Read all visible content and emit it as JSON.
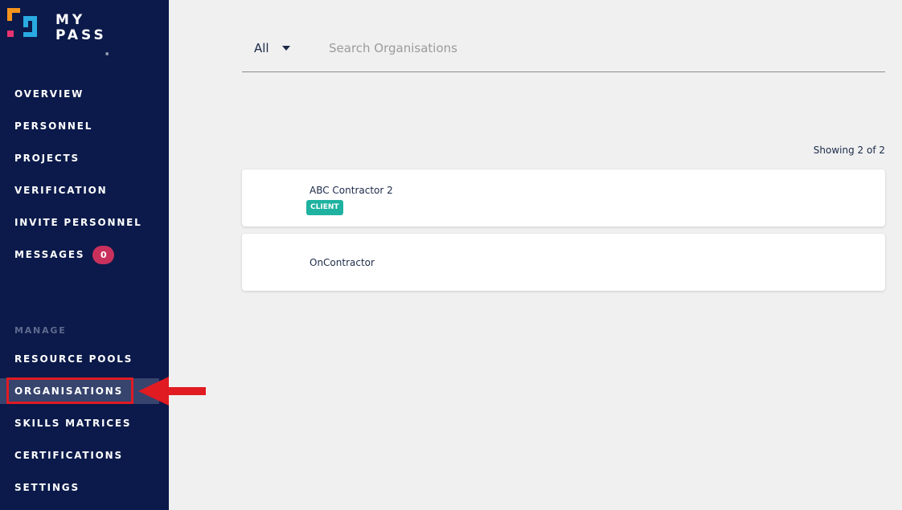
{
  "brand": {
    "line1": "MY",
    "line2": "PASS",
    "trademark": "®",
    "colors": {
      "orange": "#f7941d",
      "pink": "#e6336f",
      "cyan": "#29abe2"
    }
  },
  "sidebar": {
    "items": [
      {
        "label": "OVERVIEW"
      },
      {
        "label": "PERSONNEL"
      },
      {
        "label": "PROJECTS"
      },
      {
        "label": "VERIFICATION"
      },
      {
        "label": "INVITE PERSONNEL"
      },
      {
        "label": "MESSAGES",
        "badge": "0"
      }
    ],
    "section_label": "MANAGE",
    "manage_items": [
      {
        "label": "RESOURCE POOLS"
      },
      {
        "label": "ORGANISATIONS",
        "active": true
      },
      {
        "label": "SKILLS MATRICES"
      },
      {
        "label": "CERTIFICATIONS"
      },
      {
        "label": "SETTINGS"
      }
    ]
  },
  "filter": {
    "selected": "All",
    "search_placeholder": "Search Organisations"
  },
  "results": {
    "showing": "Showing 2 of 2"
  },
  "organisations": [
    {
      "name": "ABC Contractor 2",
      "tag": "CLIENT"
    },
    {
      "name": "OnContractor"
    }
  ],
  "colors": {
    "sidebar_bg": "#0b1a4a",
    "active_bg": "#36446e",
    "badge": "#c9315c",
    "tag": "#1fb2a0",
    "annotation": "#e01b22"
  }
}
